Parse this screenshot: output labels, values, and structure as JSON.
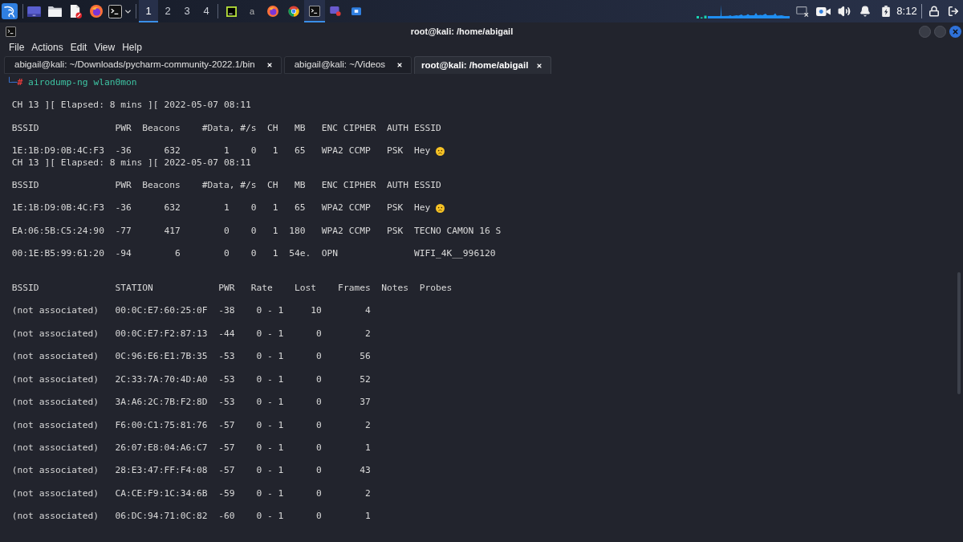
{
  "top_panel": {
    "workspaces": [
      {
        "label": "1",
        "selected": true
      },
      {
        "label": "2",
        "selected": false
      },
      {
        "label": "3",
        "selected": false
      },
      {
        "label": "4",
        "selected": false
      }
    ],
    "tasks": [
      {
        "selected": false
      },
      {
        "label": "a",
        "selected": false
      },
      {
        "selected": false
      },
      {
        "selected": false
      },
      {
        "selected": true
      },
      {
        "selected": false
      },
      {
        "selected": false
      }
    ],
    "clock": "8:12"
  },
  "terminal": {
    "title": "root@kali: /home/abigail",
    "menu": [
      "File",
      "Actions",
      "Edit",
      "View",
      "Help"
    ],
    "tabs": [
      {
        "label": "abigail@kali: ~/Downloads/pycharm-community-2022.1/bin",
        "selected": false
      },
      {
        "label": "abigail@kali: ~/Videos",
        "selected": false
      },
      {
        "label": "root@kali: /home/abigail",
        "selected": true
      }
    ],
    "prompt": {
      "corner": "└─",
      "symbol": "#",
      "command": "airodump-ng wlan0mon"
    },
    "snapshots": [
      {
        "status": "CH 13 ][ Elapsed: 8 mins ][ 2022-05-07 08:11",
        "columns": [
          "BSSID",
          "PWR",
          "Beacons",
          "#Data,",
          "#/s",
          "CH",
          "MB",
          "ENC",
          "CIPHER",
          "AUTH",
          "ESSID"
        ],
        "access_points": [
          {
            "bssid": "1E:1B:D9:0B:4C:F3",
            "pwr": "-36",
            "beacons": "632",
            "data": "1",
            "per_second": "0",
            "ch": "1",
            "mb": "65",
            "enc": "WPA2",
            "cipher": "CCMP",
            "auth": "PSK",
            "essid": "Hey",
            "emoji": true
          }
        ]
      },
      {
        "status": "CH 13 ][ Elapsed: 8 mins ][ 2022-05-07 08:11",
        "columns": [
          "BSSID",
          "PWR",
          "Beacons",
          "#Data,",
          "#/s",
          "CH",
          "MB",
          "ENC",
          "CIPHER",
          "AUTH",
          "ESSID"
        ],
        "access_points": [
          {
            "bssid": "1E:1B:D9:0B:4C:F3",
            "pwr": "-36",
            "beacons": "632",
            "data": "1",
            "per_second": "0",
            "ch": "1",
            "mb": "65",
            "enc": "WPA2",
            "cipher": "CCMP",
            "auth": "PSK",
            "essid": "Hey",
            "emoji": true
          },
          {
            "bssid": "EA:06:5B:C5:24:90",
            "pwr": "-77",
            "beacons": "417",
            "data": "0",
            "per_second": "0",
            "ch": "1",
            "mb": "180",
            "enc": "WPA2",
            "cipher": "CCMP",
            "auth": "PSK",
            "essid": "TECNO CAMON 16 S"
          },
          {
            "bssid": "00:1E:B5:99:61:20",
            "pwr": "-94",
            "beacons": "6",
            "data": "0",
            "per_second": "0",
            "ch": "1",
            "mb": "54e.",
            "enc": "OPN",
            "essid": "WIFI_4K__996120"
          }
        ]
      }
    ],
    "stations": {
      "columns": [
        "BSSID",
        "STATION",
        "PWR",
        "Rate",
        "Lost",
        "Frames",
        "Notes",
        "Probes"
      ],
      "rows": [
        {
          "bssid": "(not associated)",
          "station": "00:0C:E7:60:25:0F",
          "pwr": "-38",
          "rate": "0 - 1",
          "lost": "10",
          "frames": "4"
        },
        {
          "bssid": "(not associated)",
          "station": "00:0C:E7:F2:87:13",
          "pwr": "-44",
          "rate": "0 - 1",
          "lost": "0",
          "frames": "2"
        },
        {
          "bssid": "(not associated)",
          "station": "0C:96:E6:E1:7B:35",
          "pwr": "-53",
          "rate": "0 - 1",
          "lost": "0",
          "frames": "56"
        },
        {
          "bssid": "(not associated)",
          "station": "2C:33:7A:70:4D:A0",
          "pwr": "-53",
          "rate": "0 - 1",
          "lost": "0",
          "frames": "52"
        },
        {
          "bssid": "(not associated)",
          "station": "3A:A6:2C:7B:F2:8D",
          "pwr": "-53",
          "rate": "0 - 1",
          "lost": "0",
          "frames": "37"
        },
        {
          "bssid": "(not associated)",
          "station": "F6:00:C1:75:81:76",
          "pwr": "-57",
          "rate": "0 - 1",
          "lost": "0",
          "frames": "2"
        },
        {
          "bssid": "(not associated)",
          "station": "26:07:E8:04:A6:C7",
          "pwr": "-57",
          "rate": "0 - 1",
          "lost": "0",
          "frames": "1"
        },
        {
          "bssid": "(not associated)",
          "station": "28:E3:47:FF:F4:08",
          "pwr": "-57",
          "rate": "0 - 1",
          "lost": "0",
          "frames": "43"
        },
        {
          "bssid": "(not associated)",
          "station": "CA:CE:F9:1C:34:6B",
          "pwr": "-59",
          "rate": "0 - 1",
          "lost": "0",
          "frames": "2"
        },
        {
          "bssid": "(not associated)",
          "station": "06:DC:94:71:0C:82",
          "pwr": "-60",
          "rate": "0 - 1",
          "lost": "0",
          "frames": "1"
        }
      ]
    }
  }
}
